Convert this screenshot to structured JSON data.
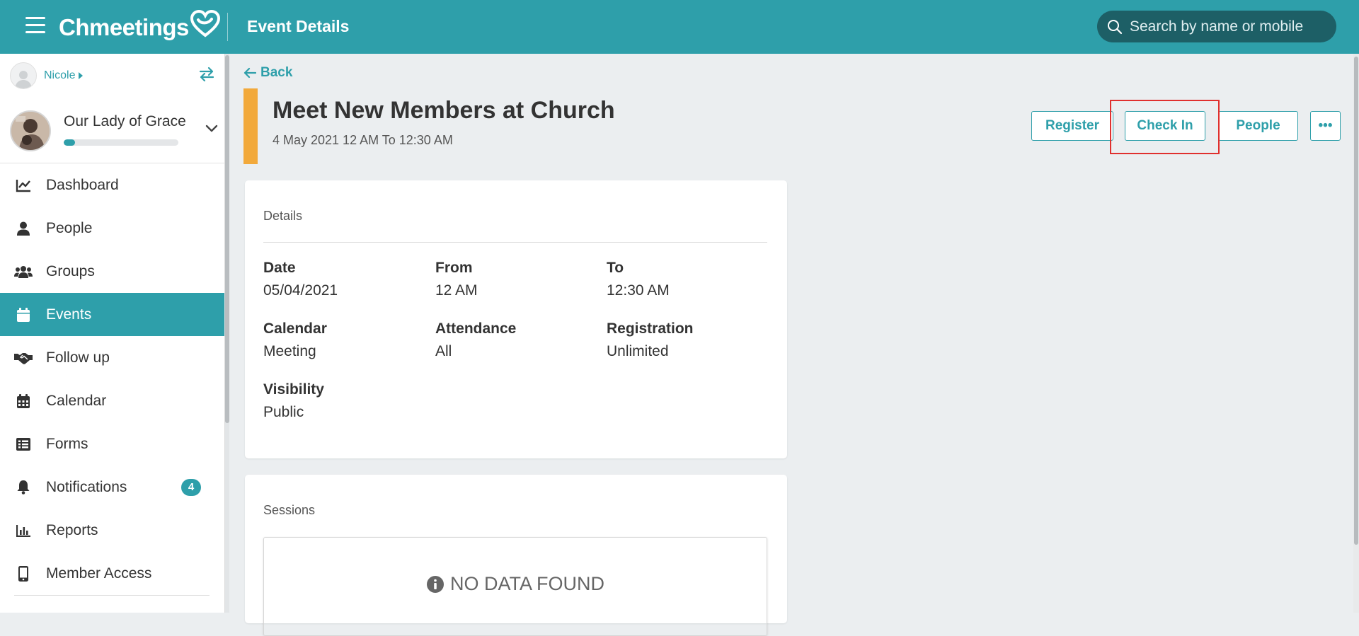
{
  "topbar": {
    "logo_text": "Chmeetings",
    "title": "Event Details",
    "search_placeholder": "Search by name or mobile"
  },
  "sidebar": {
    "user_name": "Nicole",
    "church_name": "Our Lady of Grace",
    "church_progress": 0.1,
    "items": [
      {
        "label": "Dashboard",
        "icon": "chart-line-icon",
        "active": false
      },
      {
        "label": "People",
        "icon": "person-icon",
        "active": false
      },
      {
        "label": "Groups",
        "icon": "users-icon",
        "active": false
      },
      {
        "label": "Events",
        "icon": "calendar-icon",
        "active": true
      },
      {
        "label": "Follow up",
        "icon": "handshake-icon",
        "active": false
      },
      {
        "label": "Calendar",
        "icon": "calendar-grid-icon",
        "active": false
      },
      {
        "label": "Forms",
        "icon": "list-icon",
        "active": false
      },
      {
        "label": "Notifications",
        "icon": "bell-icon",
        "active": false,
        "badge": "4"
      },
      {
        "label": "Reports",
        "icon": "bar-chart-icon",
        "active": false
      },
      {
        "label": "Member Access",
        "icon": "mobile-icon",
        "active": false
      }
    ]
  },
  "event": {
    "back_label": "Back",
    "title": "Meet New Members at Church",
    "time": "4 May 2021 12 AM To 12:30 AM",
    "stripe_color": "#f2a93b"
  },
  "actions": {
    "register": "Register",
    "check_in": "Check In",
    "people": "People",
    "more": "•••"
  },
  "details": {
    "heading": "Details",
    "fields": [
      {
        "label": "Date",
        "value": "05/04/2021"
      },
      {
        "label": "From",
        "value": "12 AM"
      },
      {
        "label": "To",
        "value": "12:30 AM"
      },
      {
        "label": "Calendar",
        "value": "Meeting"
      },
      {
        "label": "Attendance",
        "value": "All"
      },
      {
        "label": "Registration",
        "value": "Unlimited"
      },
      {
        "label": "Visibility",
        "value": "Public"
      }
    ]
  },
  "sessions": {
    "heading": "Sessions",
    "empty_text": "NO DATA FOUND"
  },
  "colors": {
    "accent": "#2e9faa",
    "highlight": "#e0302e"
  }
}
